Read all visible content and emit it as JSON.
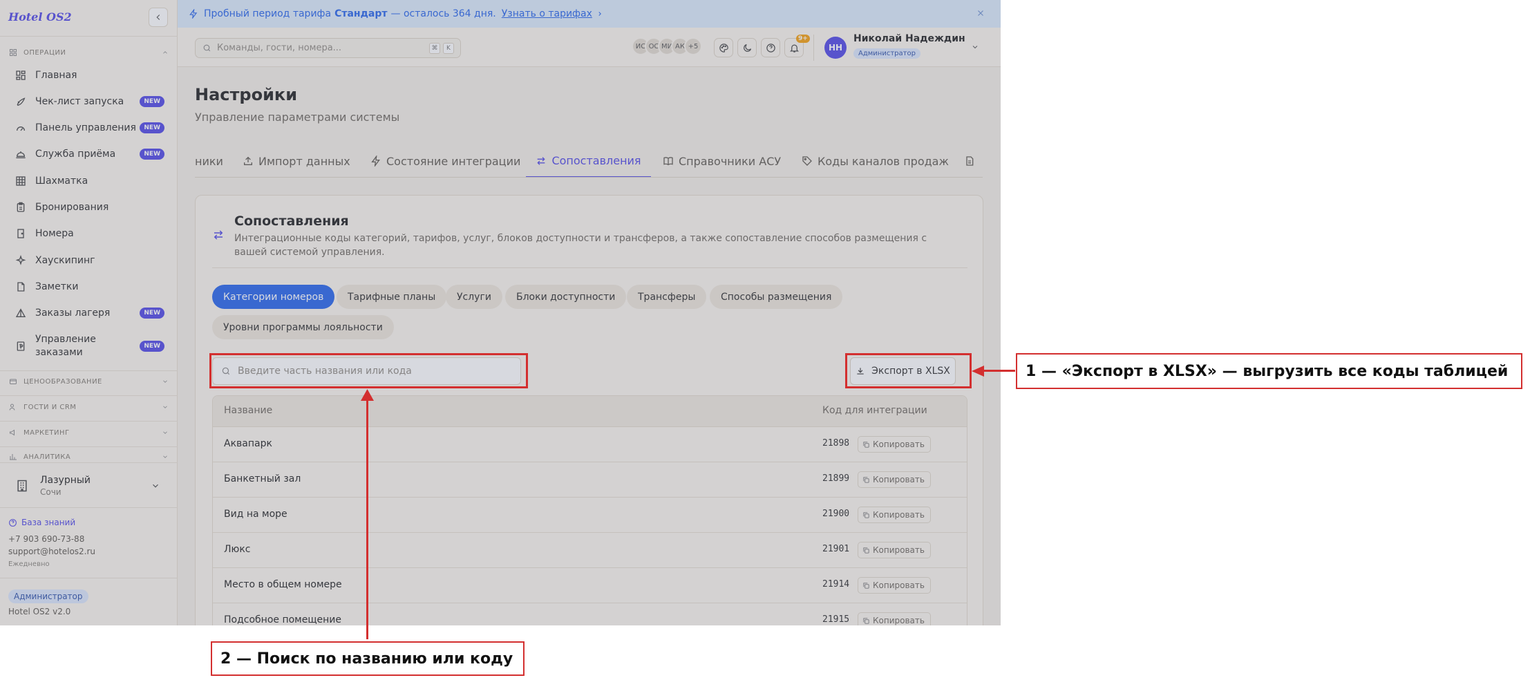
{
  "sidebar": {
    "brand": "Hotel OS2",
    "sections": {
      "operations": "ОПЕРАЦИИ",
      "pricing": "ЦЕНООБРАЗОВАНИЕ",
      "guests": "ГОСТИ И CRM",
      "marketing": "МАРКЕТИНГ",
      "analytics": "АНАЛИТИКА"
    },
    "items": [
      {
        "label": "Главная",
        "icon": "grid-icon",
        "new": false
      },
      {
        "label": "Чек-лист запуска",
        "icon": "rocket-icon",
        "new": true
      },
      {
        "label": "Панель управления",
        "icon": "gauge-icon",
        "new": true
      },
      {
        "label": "Служба приёма",
        "icon": "bell-service-icon",
        "new": true
      },
      {
        "label": "Шахматка",
        "icon": "table-icon",
        "new": false
      },
      {
        "label": "Бронирования",
        "icon": "clipboard-icon",
        "new": false
      },
      {
        "label": "Номера",
        "icon": "door-icon",
        "new": false
      },
      {
        "label": "Хаускипинг",
        "icon": "sparkles-icon",
        "new": false
      },
      {
        "label": "Заметки",
        "icon": "note-icon",
        "new": false
      },
      {
        "label": "Заказы лагеря",
        "icon": "tent-icon",
        "new": true
      },
      {
        "label": "Управление заказами",
        "icon": "receipt-icon",
        "new": true
      }
    ],
    "new_badge": "NEW",
    "hotel": {
      "name": "Лазурный",
      "city": "Сочи"
    },
    "knowledge_base": "База знаний",
    "phone": "+7 903 690-73-88",
    "email": "support@hotelos2.ru",
    "schedule": "Ежедневно",
    "role": "Администратор",
    "version": "Hotel OS2 v2.0"
  },
  "trial": {
    "text_before": "Пробный период тарифа",
    "plan": "Стандарт",
    "text_after": "— осталось 364 дня.",
    "link": "Узнать о тарифах"
  },
  "topbar": {
    "search_placeholder": "Команды, гости, номера...",
    "shortcut_mod": "⌘",
    "shortcut_key": "K",
    "avatars": [
      "ИС",
      "ОС",
      "МИ",
      "АК"
    ],
    "avatars_more": "+5",
    "notif_count": "9+",
    "user_initials": "НН",
    "user_name": "Николай Надеждин",
    "user_role": "Администратор"
  },
  "page": {
    "title": "Настройки",
    "subtitle": "Управление параметрами системы",
    "tabs": [
      {
        "label": "ники",
        "icon": ""
      },
      {
        "label": "Импорт данных",
        "icon": "upload-icon"
      },
      {
        "label": "Состояние интеграции",
        "icon": "zap-icon"
      },
      {
        "label": "Сопоставления",
        "icon": "arrows-swap-icon"
      },
      {
        "label": "Справочники АСУ",
        "icon": "book-icon"
      },
      {
        "label": "Коды каналов продаж",
        "icon": "tag-icon"
      }
    ]
  },
  "card": {
    "title": "Сопоставления",
    "description": "Интеграционные коды категорий, тарифов, услуг, блоков доступности и трансферов, а также сопоставление способов размещения с вашей системой управления.",
    "chips": [
      "Категории номеров",
      "Тарифные планы",
      "Услуги",
      "Блоки доступности",
      "Трансферы",
      "Способы размещения",
      "Уровни программы лояльности"
    ],
    "search_placeholder": "Введите часть названия или кода",
    "export_label": "Экспорт в XLSX",
    "table": {
      "col_name": "Название",
      "col_code": "Код для интеграции",
      "copy_label": "Копировать",
      "rows": [
        {
          "name": "Аквапарк",
          "code": "21898"
        },
        {
          "name": "Банкетный зал",
          "code": "21899"
        },
        {
          "name": "Вид на море",
          "code": "21900"
        },
        {
          "name": "Люкс",
          "code": "21901"
        },
        {
          "name": "Место в общем номере",
          "code": "21914"
        },
        {
          "name": "Подсобное помещение",
          "code": "21915"
        }
      ]
    }
  },
  "annotations": {
    "callout_1": "1 — «Экспорт в XLSX» — выгрузить все коды таблицей",
    "callout_2": "2 — Поиск по названию или коду"
  },
  "colors": {
    "accent": "#4f46e5",
    "primary_blue": "#2563eb",
    "annotation_red": "#d32f2f"
  }
}
